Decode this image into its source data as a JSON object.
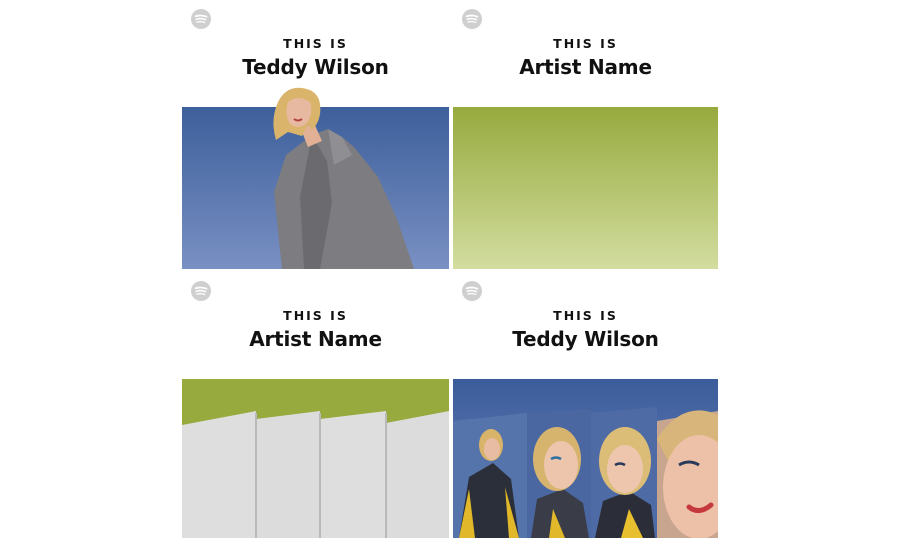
{
  "cards": [
    {
      "kicker": "THIS IS",
      "name": "Teddy Wilson",
      "style": "single-portrait",
      "colors": {
        "top": "#3d5f9b",
        "bottom": "#7990c3",
        "coat": "#7d7c80"
      }
    },
    {
      "kicker": "THIS IS",
      "name": "Artist Name",
      "style": "blank-gradient",
      "colors": {
        "top": "#97aa3e",
        "bottom": "#d2dd9f"
      }
    },
    {
      "kicker": "THIS IS",
      "name": "Artist Name",
      "style": "blank-panels",
      "colors": {
        "top": "#97aa3e",
        "panel": "#dedede"
      }
    },
    {
      "kicker": "THIS IS",
      "name": "Teddy Wilson",
      "style": "multi-portrait",
      "colors": {
        "top": "#3b5c9a",
        "bottom": "#6e87bf"
      }
    }
  ],
  "icon": "spotify-logo-icon"
}
